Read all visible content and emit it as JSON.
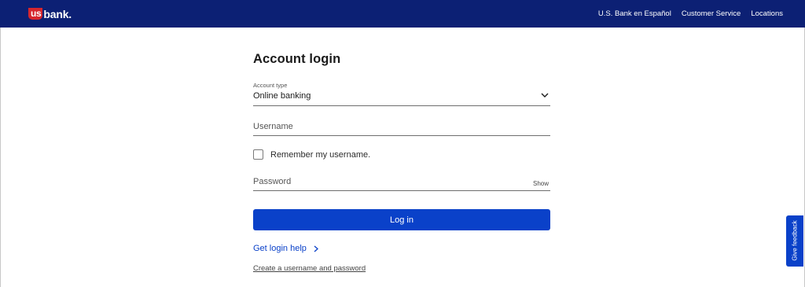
{
  "header": {
    "logo": {
      "mark": "us",
      "name": "bank",
      "dot": "."
    },
    "links": [
      "U.S. Bank en Español",
      "Customer Service",
      "Locations"
    ]
  },
  "login_form": {
    "title": "Account login",
    "account_type": {
      "label": "Account type",
      "value": "Online banking",
      "icon": "chevron-down-icon"
    },
    "username": {
      "placeholder": "Username"
    },
    "remember": {
      "label": "Remember my username.",
      "checked": false
    },
    "password": {
      "placeholder": "Password",
      "show_label": "Show"
    },
    "submit_label": "Log in",
    "help_link": {
      "label": "Get login help",
      "icon": "chevron-right-icon"
    },
    "create_link": "Create a username and password"
  },
  "feedback_tab": {
    "label": "Give feedback"
  },
  "colors": {
    "header_bg": "#0c2074",
    "brand_red": "#d6262d",
    "primary_blue": "#0a41c9",
    "text": "#2c2c2c"
  }
}
